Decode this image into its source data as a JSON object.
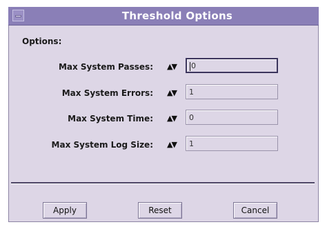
{
  "window": {
    "title": "Threshold Options"
  },
  "options_heading": "Options:",
  "rows": [
    {
      "label": "Max System Passes:",
      "value": "0"
    },
    {
      "label": "Max System Errors:",
      "value": "1"
    },
    {
      "label": "Max System Time:",
      "value": "0"
    },
    {
      "label": "Max System Log Size:",
      "value": "1"
    }
  ],
  "stepper_glyph": "▲▼",
  "buttons": {
    "apply": "Apply",
    "reset": "Reset",
    "cancel": "Cancel"
  }
}
